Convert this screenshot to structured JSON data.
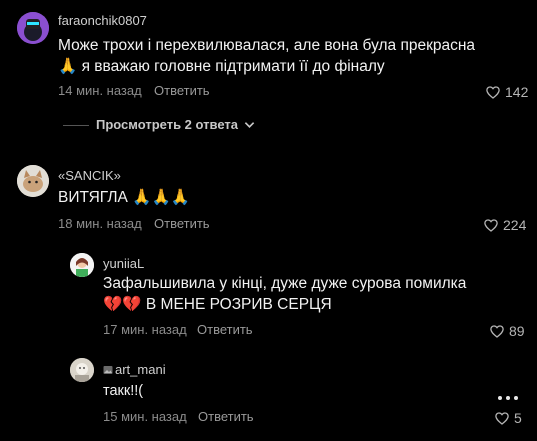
{
  "comments": [
    {
      "username": "faraonchik0807",
      "text_line1": "Може трохи і перехвилювалася, але вона була прекрасна",
      "text_line2": "🙏 я вважаю головне підтримати її до фіналу",
      "time": "14 мин. назад",
      "reply_label": "Ответить",
      "likes": "142"
    },
    {
      "username": "«SANCIK»",
      "text_line1": "ВИТЯГЛА 🙏🙏🙏",
      "time": "18 мин. назад",
      "reply_label": "Ответить",
      "likes": "224"
    }
  ],
  "view_replies": "Просмотреть 2 ответа",
  "replies": [
    {
      "username": "yuniiaL",
      "text_line1": "Зафальшивила у кінці, дуже дуже сурова помилка",
      "text_line2": "💔💔 В МЕНЕ РОЗРИВ СЕРЦЯ",
      "time": "17 мин. назад",
      "reply_label": "Ответить",
      "likes": "89"
    },
    {
      "username": "art_mani",
      "text_line1": "такк!!(",
      "time": "15 мин. назад",
      "reply_label": "Ответить",
      "likes": "5"
    }
  ],
  "icons": {
    "like": "heart-outline-icon",
    "expand": "chevron-down-icon",
    "more": "more-dots-icon"
  },
  "colors": {
    "background": "#000000",
    "text": "#f2f2f2",
    "meta": "#8c8c8c"
  }
}
